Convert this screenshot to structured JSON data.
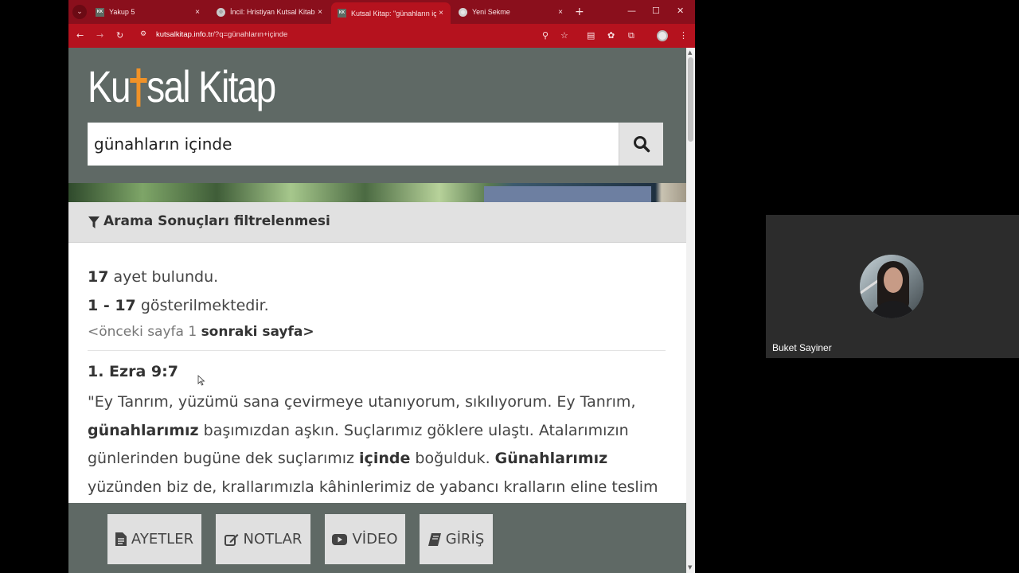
{
  "browser": {
    "tabs": [
      {
        "favicon": "KK",
        "title": "Yakup 5",
        "active": false
      },
      {
        "favicon": "globe",
        "title": "İncil: Hristiyan Kutsal Kitabı",
        "active": false
      },
      {
        "favicon": "KK",
        "title": "Kutsal Kitap: \"günahların iç",
        "active": true
      },
      {
        "favicon": "chrome",
        "title": "Yeni Sekme",
        "active": false
      }
    ],
    "tab_close_glyph": "×",
    "new_tab_glyph": "+",
    "url_host": "kutsalkitap.info.tr",
    "url_path": "/?q=günahların+içinde"
  },
  "page": {
    "logo_left": "Ku",
    "logo_right": "sal Kitap",
    "search_value": "günahların içinde",
    "filter_label": "Arama Sonuçları filtrelenmesi",
    "results": {
      "count": "17",
      "count_suffix": " ayet bulundu.",
      "range": "1 - 17",
      "range_suffix": " gösterilmektedir.",
      "prev_page": "<önceki sayfa",
      "page_number": " 1 ",
      "next_page": "sonraki sayfa>"
    },
    "verse": {
      "reference": "1. Ezra 9:7",
      "lines": [
        [
          {
            "t": "\"Ey Tanrım, yüzümü sana çevirmeye utanıyorum, sıkılıyorum. Ey Tanrım,",
            "b": false
          }
        ],
        [
          {
            "t": "günahlarımız",
            "b": true
          },
          {
            "t": " başımızdan aşkın. Suçlarımız göklere ulaştı. Atalarımızın",
            "b": false
          }
        ],
        [
          {
            "t": "günlerinden bugüne dek suçlarımız ",
            "b": false
          },
          {
            "t": "içinde",
            "b": true
          },
          {
            "t": " boğulduk. ",
            "b": false
          },
          {
            "t": "Günahlarımız",
            "b": true
          }
        ],
        [
          {
            "t": "yüzünden biz de, krallarımızla kâhinlerimiz de yabancı kralların eline teslim",
            "b": false
          }
        ]
      ]
    },
    "bottom_nav": [
      {
        "label": "AYETLER",
        "icon": "file-icon"
      },
      {
        "label": "NOTLAR",
        "icon": "edit-icon"
      },
      {
        "label": "VİDEO",
        "icon": "youtube-icon"
      },
      {
        "label": "GİRİŞ",
        "icon": "book-icon"
      }
    ]
  },
  "call": {
    "participant_name": "Buket Sayiner"
  },
  "colors": {
    "tab_bar": "#8a0f1c",
    "toolbar": "#b5121e",
    "header": "#5f6965",
    "logo_accent": "#f09228"
  }
}
